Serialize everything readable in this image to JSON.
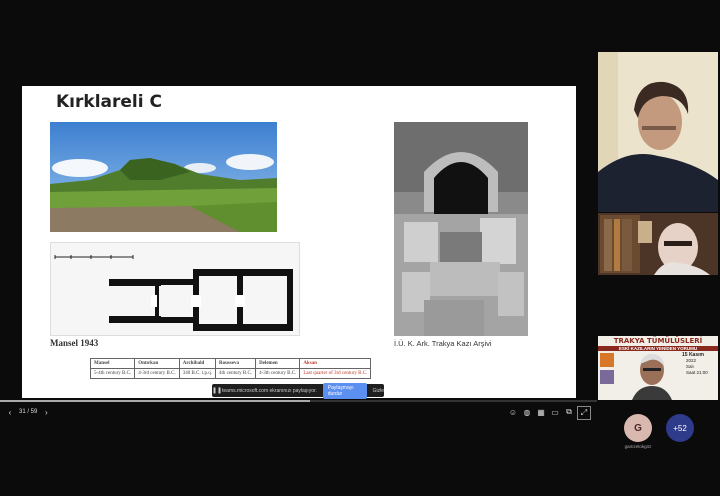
{
  "slide": {
    "title": "Kırklareli C",
    "caption_left": "Mansel 1943",
    "caption_right": "İ.Ü. K. Ark. Trakya Kazı Arşivi",
    "table": {
      "headers": [
        "Mansel",
        "Ontırkan",
        "Archibald",
        "Rousseva",
        "Delemen",
        "Aksan"
      ],
      "row": [
        "5-4th century B.C.",
        "4-3rd century B.C.",
        "340 B.C. t.p.q.",
        "4th century B.C.",
        "4-3th century B.C.",
        "Last quarter of 3rd century B.C."
      ]
    }
  },
  "share_bar": {
    "pause": "❚❚",
    "message": "teams.microsoft.com ekranınızı paylaşıyor.",
    "stop_label": "Paylaşmayı durdur",
    "hide_label": "Gizle"
  },
  "viewer": {
    "page_counter": "31 / 59",
    "progress": 0.52
  },
  "participants": {
    "avatar_initial": "G",
    "avatar_name": "gamzetokgöz",
    "more_count": "+52"
  },
  "poster": {
    "line1": "TRAKYA TÜMÜLÜSLERİ",
    "line2": "ESKİ KAZILARIN YENİDEN YORUMU",
    "date": "15 Kasım",
    "year": "2022",
    "day": "Salı",
    "time": "Saat 21:00"
  },
  "colors": {
    "share_stop": "#5b8ff0",
    "highlight": "#c0392b",
    "more_avatar": "#2e3a8a"
  }
}
